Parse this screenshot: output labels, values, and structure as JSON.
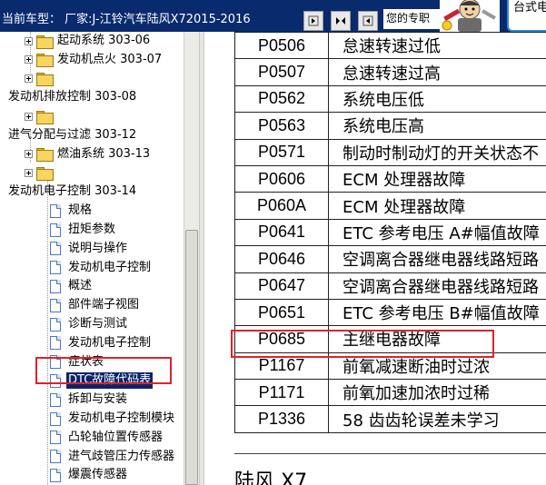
{
  "header": {
    "vehicle": "当前车型： 厂家:J-江铃汽车陆风X72015-2016",
    "welcome": "您的专职",
    "brand": "台式电",
    "nav_buttons": [
      "nav-prev-icon",
      "nav-sync-icon",
      "nav-next-icon"
    ]
  },
  "tree": {
    "items": [
      {
        "label": "起动系统 303-06",
        "type": "folder",
        "expander": true
      },
      {
        "label": "发动机点火 303-07",
        "type": "folder",
        "expander": true
      },
      {
        "label": "",
        "type": "folder",
        "expander": true
      },
      {
        "label": "发动机排放控制 303-08",
        "type": "text"
      },
      {
        "label": "",
        "type": "folder",
        "expander": true
      },
      {
        "label": "进气分配与过滤 303-12",
        "type": "text"
      },
      {
        "label": "燃油系统 303-13",
        "type": "folder",
        "expander": true
      },
      {
        "label": "",
        "type": "folder",
        "expander": true
      },
      {
        "label": "发动机电子控制 303-14",
        "type": "text"
      },
      {
        "label": "规格",
        "type": "doc"
      },
      {
        "label": "扭矩参数",
        "type": "doc"
      },
      {
        "label": "说明与操作",
        "type": "doc"
      },
      {
        "label": "发动机电子控制",
        "type": "doc"
      },
      {
        "label": "概述",
        "type": "doc"
      },
      {
        "label": "部件端子视图",
        "type": "doc"
      },
      {
        "label": "诊断与测试",
        "type": "doc"
      },
      {
        "label": "发动机电子控制",
        "type": "doc"
      },
      {
        "label": "症状表",
        "type": "doc"
      },
      {
        "label": "DTC故障代码表",
        "type": "doc",
        "selected": true
      },
      {
        "label": "拆卸与安装",
        "type": "doc"
      },
      {
        "label": "发动机电子控制模块",
        "type": "doc"
      },
      {
        "label": "凸轮轴位置传感器",
        "type": "doc"
      },
      {
        "label": "进气歧管压力传感器",
        "type": "doc"
      },
      {
        "label": "爆震传感器",
        "type": "doc"
      }
    ]
  },
  "dtc_table": {
    "rows": [
      {
        "code": "P0506",
        "desc": "怠速转速过低"
      },
      {
        "code": "P0507",
        "desc": "怠速转速过高"
      },
      {
        "code": "P0562",
        "desc": "系统电压低"
      },
      {
        "code": "P0563",
        "desc": "系统电压高"
      },
      {
        "code": "P0571",
        "desc": "制动时制动灯的开关状态不"
      },
      {
        "code": "P0606",
        "desc": "ECM 处理器故障"
      },
      {
        "code": "P060A",
        "desc": "ECM 处理器故障"
      },
      {
        "code": "P0641",
        "desc": "ETC 参考电压 A#幅值故障"
      },
      {
        "code": "P0646",
        "desc": "空调离合器继电器线路短路"
      },
      {
        "code": "P0647",
        "desc": "空调离合器继电器线路短路"
      },
      {
        "code": "P0651",
        "desc": "ETC 参考电压 B#幅值故障"
      },
      {
        "code": "P0685",
        "desc": "主继电器故障",
        "highlighted": true
      },
      {
        "code": "P1167",
        "desc": "前氧减速断油时过浓"
      },
      {
        "code": "P1171",
        "desc": "前氧加速加浓时过稀"
      },
      {
        "code": "P1336",
        "desc": "58 齿齿轮误差未学习"
      }
    ]
  },
  "content_heading": "陆风 X7",
  "highlight_color": "#e0222a",
  "selection_color": "#0a246a"
}
